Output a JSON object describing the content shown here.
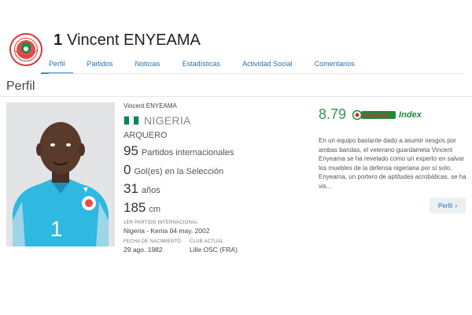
{
  "player": {
    "number": "1",
    "name": "Vincent ENYEAMA"
  },
  "tabs": [
    {
      "label": "Perfil",
      "active": true
    },
    {
      "label": "Partidos",
      "active": false
    },
    {
      "label": "Noticias",
      "active": false
    },
    {
      "label": "Estadísticas",
      "active": false
    },
    {
      "label": "Actividad Social",
      "active": false
    },
    {
      "label": "Comentarios",
      "active": false
    }
  ],
  "section_title": "Perfil",
  "profile": {
    "full_name": "Vincent ENYEAMA",
    "nationality": "NIGERIA",
    "position": "ARQUERO",
    "caps_value": "95",
    "caps_label": "Partidos internacionales",
    "goals_value": "0",
    "goals_label": "Gol(es) en la Selección",
    "age_value": "31",
    "age_label": "años",
    "height_value": "185",
    "height_label": "cm",
    "first_match_label": "1ER PARTIDO INTERNACIONAL",
    "first_match_value": "Nigeria - Kenia 04 may. 2002",
    "birth_label": "FECHA DE NACIMIENTO",
    "birth_value": "29 ago. 1982",
    "club_label": "CLUB ACTUAL",
    "club_value": "Lille OSC (FRA)"
  },
  "index": {
    "score": "8.79",
    "brand": "Castrol",
    "word": "Index"
  },
  "description": "En un equipo bastante dado a asumir riesgos por ambas bandas, el veterano guardameta Vincent Enyeama se ha revelado como un experto en salvar los muebles de la defensa nigeriana por sí solo. Enyeama, un portero de aptitudes acrobáticas, se ha vis...",
  "profile_button": {
    "label": "Perfil",
    "arrow": "›"
  },
  "colors": {
    "accent": "#2a6fb0",
    "nigeria_green": "#008751",
    "jersey": "#2fb8e0",
    "index_green": "#2e9b4a"
  }
}
